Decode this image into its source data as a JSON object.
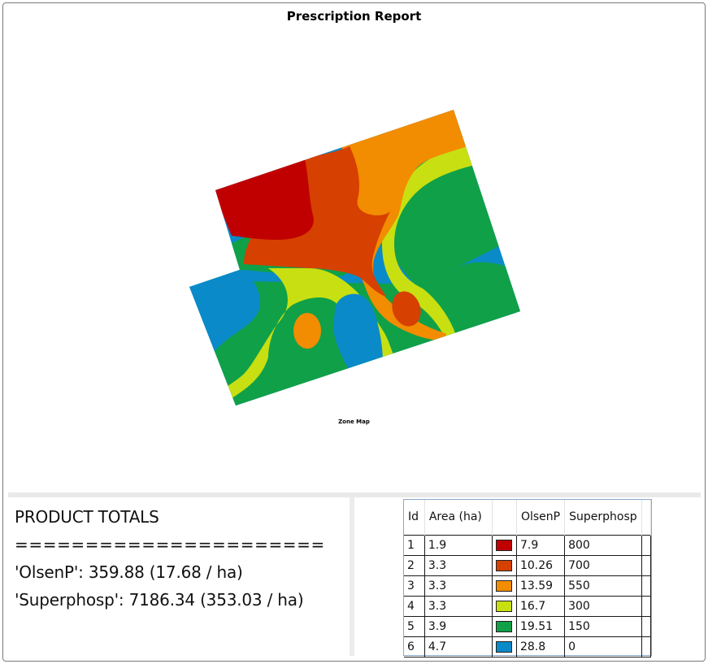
{
  "report": {
    "title": "Prescription Report",
    "map_caption": "Zone Map"
  },
  "zone_colors": [
    "#c00000",
    "#d64000",
    "#f28c00",
    "#c8df12",
    "#10a048",
    "#0a8ac8"
  ],
  "totals": {
    "heading": "PRODUCT TOTALS",
    "separator": "======================",
    "olsen_line": "'OlsenP': 359.88 (17.68 / ha)",
    "superphosp_line": "'Superphosp': 7186.34 (353.03 / ha)"
  },
  "zone_table": {
    "columns": [
      "Id",
      "Area (ha)",
      "",
      "OlsenP",
      "Superphosp"
    ],
    "rows": [
      {
        "id": "1",
        "area": "1.9",
        "color": "#c00000",
        "olsenp": "7.9",
        "superphosp": "800"
      },
      {
        "id": "2",
        "area": "3.3",
        "color": "#d64000",
        "olsenp": "10.26",
        "superphosp": "700"
      },
      {
        "id": "3",
        "area": "3.3",
        "color": "#f28c00",
        "olsenp": "13.59",
        "superphosp": "550"
      },
      {
        "id": "4",
        "area": "3.3",
        "color": "#c8df12",
        "olsenp": "16.7",
        "superphosp": "300"
      },
      {
        "id": "5",
        "area": "3.9",
        "color": "#10a048",
        "olsenp": "19.51",
        "superphosp": "150"
      },
      {
        "id": "6",
        "area": "4.7",
        "color": "#0a8ac8",
        "olsenp": "28.8",
        "superphosp": "0"
      }
    ]
  }
}
